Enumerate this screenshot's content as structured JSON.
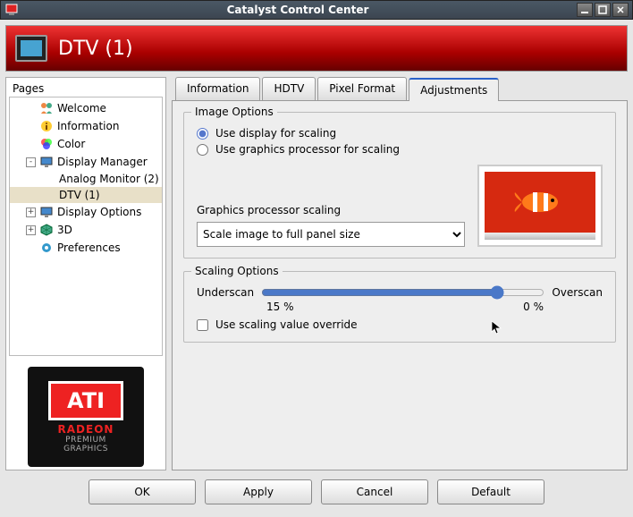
{
  "window": {
    "title": "Catalyst Control Center"
  },
  "banner": {
    "title": "DTV (1)"
  },
  "sidebar": {
    "label": "Pages",
    "nodes": [
      {
        "exp": "",
        "icon": "people",
        "label": "Welcome",
        "level": 1
      },
      {
        "exp": "",
        "icon": "info",
        "label": "Information",
        "level": 1
      },
      {
        "exp": "",
        "icon": "color",
        "label": "Color",
        "level": 1
      },
      {
        "exp": "-",
        "icon": "monitor",
        "label": "Display Manager",
        "level": 1
      },
      {
        "exp": "",
        "icon": "",
        "label": "Analog Monitor (2)",
        "level": 2
      },
      {
        "exp": "",
        "icon": "",
        "label": "DTV (1)",
        "level": 2,
        "sel": true
      },
      {
        "exp": "+",
        "icon": "monitor",
        "label": "Display Options",
        "level": 1
      },
      {
        "exp": "+",
        "icon": "3d",
        "label": "3D",
        "level": 1
      },
      {
        "exp": "",
        "icon": "gear",
        "label": "Preferences",
        "level": 1
      }
    ]
  },
  "badge": {
    "brand": "ATI",
    "line1": "RADEON",
    "line2": "PREMIUM",
    "line3": "GRAPHICS"
  },
  "tabs": [
    {
      "label": "Information"
    },
    {
      "label": "HDTV"
    },
    {
      "label": "Pixel Format"
    },
    {
      "label": "Adjustments",
      "active": true
    }
  ],
  "imageOptions": {
    "legend": "Image Options",
    "radio1": "Use display for scaling",
    "radio2": "Use graphics processor for scaling",
    "gpuLabel": "Graphics processor scaling",
    "scaleSelected": "Scale image to full panel size"
  },
  "scalingOptions": {
    "legend": "Scaling Options",
    "underscan": "Underscan",
    "overscan": "Overscan",
    "tickLeft": "15 %",
    "tickRight": "0 %",
    "sliderValue": 85,
    "overrideLabel": "Use scaling value override"
  },
  "buttons": {
    "ok": "OK",
    "apply": "Apply",
    "cancel": "Cancel",
    "default": "Default"
  }
}
